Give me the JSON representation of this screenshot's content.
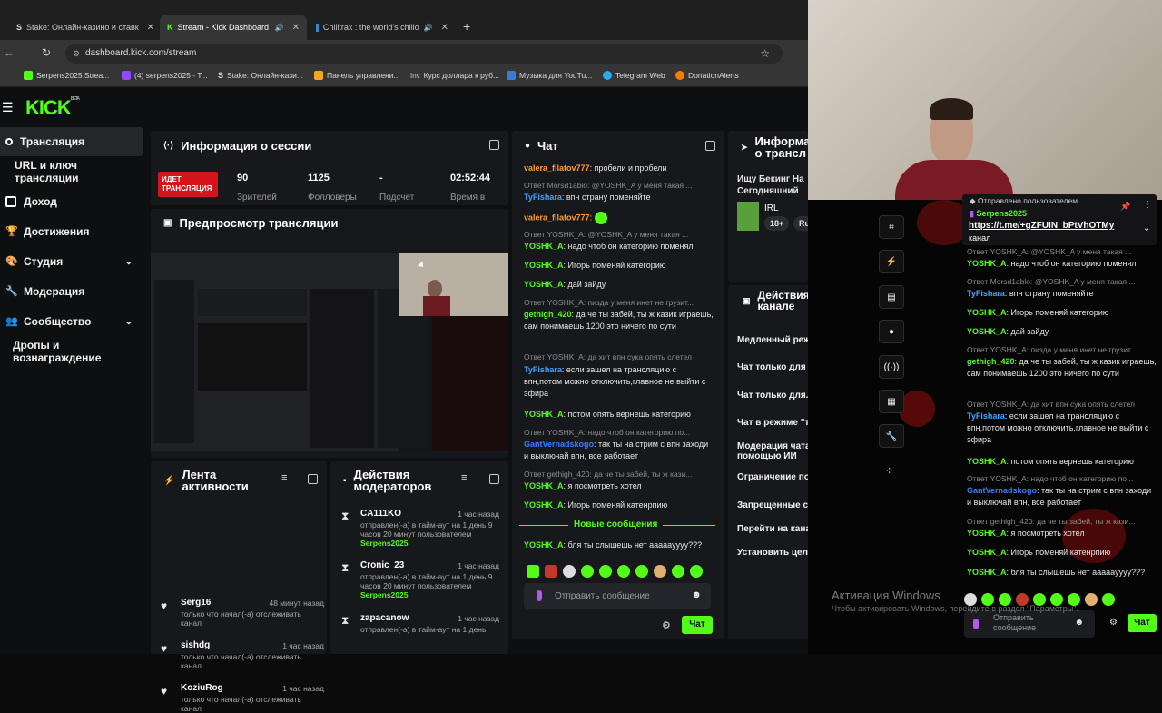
{
  "browser": {
    "tabs": [
      {
        "label": "Stake: Онлайн-казино и ставк"
      },
      {
        "label": "Stream - Kick Dashboard"
      },
      {
        "label": "Chilltrax : the world's chillo"
      }
    ],
    "url": "dashboard.kick.com/stream",
    "bookmarks": [
      "Serpens2025 Strea...",
      "(4) serpens2025 - T...",
      "Stake: Онлайн-кази...",
      "Панель управлени...",
      "Курс доллара к руб...",
      "Музыка для YouTu...",
      "Telegram Web",
      "DonationAlerts"
    ]
  },
  "brand": {
    "logo": "KICK",
    "beta": "BETA",
    "accent": "#53fc18"
  },
  "sidebar": {
    "items": [
      {
        "label": "Трансляция"
      },
      {
        "label": "URL и ключ трансляции"
      },
      {
        "label": "Доход"
      },
      {
        "label": "Достижения"
      },
      {
        "label": "Студия"
      },
      {
        "label": "Модерация"
      },
      {
        "label": "Сообщество"
      },
      {
        "label": "Дропы и вознаграждение"
      }
    ]
  },
  "session": {
    "title": "Информация о сессии",
    "live_badge": "ИДЕТ ТРАНСЛЯЦИЯ",
    "stats": [
      {
        "value": "90",
        "label": "Зрителей"
      },
      {
        "value": "1125",
        "label": "Фолловеры"
      },
      {
        "value": "-",
        "label": "Подсчет"
      },
      {
        "value": "02:52:44",
        "label": "Время в"
      }
    ]
  },
  "preview": {
    "title": "Предпросмотр трансляции"
  },
  "activity": {
    "title": "Лента активности",
    "items": [
      {
        "name": "Serg16",
        "time": "48 минут назад",
        "desc": "только что начал(-а) отслеживать канал"
      },
      {
        "name": "sishdg",
        "time": "1 час назад",
        "desc": "только что начал(-а) отслеживать канал"
      },
      {
        "name": "KoziuRog",
        "time": "1 час назад",
        "desc": "только что начал(-а) отслеживать канал"
      }
    ]
  },
  "modactions": {
    "title": "Действия модераторов",
    "items": [
      {
        "name": "CA111KO",
        "time": "1 час назад",
        "desc": "отправлен(-а) в тайм-аут на 1 день 9 часов 20 минут пользователем",
        "by": "Serpens2025"
      },
      {
        "name": "Cronic_23",
        "time": "1 час назад",
        "desc": "отправлен(-а) в тайм-аут на 1 день 9 часов 20 минут пользователем",
        "by": "Serpens2025"
      },
      {
        "name": "zapacanow",
        "time": "1 час назад",
        "desc": "отправлен(-а) в тайм-аут на 1 день",
        "by": ""
      }
    ]
  },
  "chat": {
    "title": "Чат",
    "messages": [
      {
        "reply": "",
        "user": "valera_filatov777",
        "text": ": пробели и пробели",
        "color": "#ff9b2f"
      },
      {
        "reply": "Ответ Morsd1ablo: @YOSHK_A у меня такая ...",
        "user": "TyFishara",
        "text": ": впн страну поменяйте",
        "color": "#3da5ff"
      },
      {
        "reply": "",
        "user": "valera_filatov777",
        "text": ":",
        "color": "#ff9b2f"
      },
      {
        "reply": "Ответ YOSHK_A: @YOSHK_A у меня такая ...",
        "user": "YOSHK_A",
        "text": ": надо чтоб он категорию поменял",
        "color": "#53fc18"
      },
      {
        "reply": "",
        "user": "YOSHK_A",
        "text": ": Игорь поменяй категорию",
        "color": "#53fc18"
      },
      {
        "reply": "",
        "user": "YOSHK_A",
        "text": ": дай зайду",
        "color": "#53fc18"
      },
      {
        "reply": "Ответ YOSHK_A: пизда у меня инет не грузит...",
        "user": "gethigh_420",
        "text": ": да че ты забей, ты ж казик играешь, сам понимаешь 1200 это ничего по сути",
        "color": "#53fc18"
      },
      {
        "reply": "Ответ YOSHK_A: да хит впн сука опять слетел",
        "user": "TyFishara",
        "text": ": если зашел на трансляцию с впн,потом можно отключить,главное не выйти с эфира",
        "color": "#3da5ff"
      },
      {
        "reply": "",
        "user": "YOSHK_A",
        "text": ": потом опять вернешь категорию",
        "color": "#53fc18"
      },
      {
        "reply": "Ответ YOSHK_A: надо чтоб он категорию по...",
        "user": "GantVernadskogo",
        "text": ": так ты на стрим с впн заходи и выключай впн, все работает",
        "color": "#3d7bff"
      },
      {
        "reply": "Ответ gethigh_420: да че ты забей, ты ж кази...",
        "user": "YOSHK_A",
        "text": ": я посмотреть хотел",
        "color": "#53fc18"
      },
      {
        "reply": "",
        "user": "YOSHK_A",
        "text": ": Игорь поменяй катенрпию",
        "color": "#53fc18"
      },
      {
        "reply": "",
        "user": "YOSHK_A",
        "text": ": бля ты слышешь нет аааааyyyy???",
        "color": "#53fc18"
      }
    ],
    "new_messages": "Новые сообщения",
    "input_placeholder": "Отправить сообщение",
    "send_label": "Чат"
  },
  "info": {
    "title": "Информа о трансл",
    "stream_title": "Ищу Бекинг На Сегодняшний За",
    "category": "IRL",
    "tags": [
      "18+",
      "Russian"
    ]
  },
  "channel_actions": {
    "title": "Действия на канале",
    "items": [
      {
        "label": "Медленный режим",
        "kind": "arrow"
      },
      {
        "label": "Чат только для фолловеров",
        "kind": "arrow"
      },
      {
        "label": "Чат только для...",
        "kind": "toggle"
      },
      {
        "label": "Чат в режиме \"толь...",
        "kind": "toggle"
      },
      {
        "label": "Модерация чата с помощью ИИ",
        "kind": "external"
      },
      {
        "label": "Ограничение по возрасту",
        "kind": "arrow"
      },
      {
        "label": "Запрещенные слова",
        "kind": "arrow"
      },
      {
        "label": "Перейти на канал",
        "kind": "none"
      },
      {
        "label": "Установить цели",
        "kind": "arrow"
      }
    ]
  },
  "overlay_chat": {
    "pinned_label": "Отправлено пользователем",
    "pinned_user": "Serpens2025",
    "pinned_link": "https://t.me/+gZFUIN_bPtVhOTMy",
    "pinned_suffix": "канал",
    "input_placeholder": "Отправить сообщение",
    "send_label": "Чат"
  },
  "windows_watermark": {
    "title": "Активация Windows",
    "subtitle": "Чтобы активировать Windows, перейдите в раздел \"Параметры\"."
  }
}
